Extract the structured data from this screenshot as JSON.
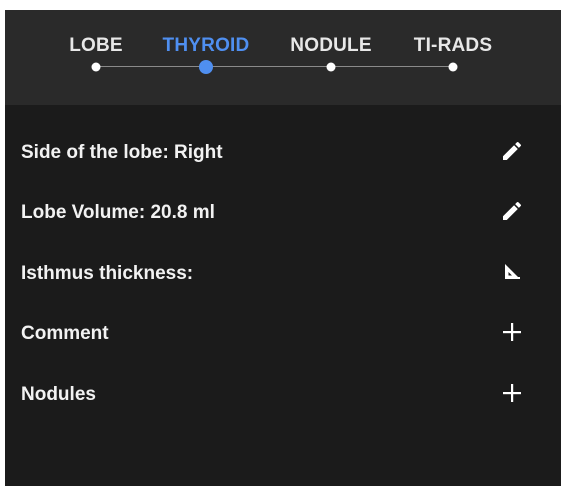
{
  "stepper": {
    "steps": [
      {
        "label": "LOBE",
        "active": false
      },
      {
        "label": "THYROID",
        "active": true
      },
      {
        "label": "NODULE",
        "active": false
      },
      {
        "label": "TI-RADS",
        "active": false
      }
    ],
    "active_color": "#4f8ff0"
  },
  "rows": [
    {
      "label": "Side of the lobe: Right",
      "icon": "pencil-icon"
    },
    {
      "label": "Lobe Volume: 20.8 ml",
      "icon": "pencil-icon"
    },
    {
      "label": "Isthmus thickness:",
      "icon": "ruler-triangle-icon"
    },
    {
      "label": "Comment",
      "icon": "plus-icon"
    },
    {
      "label": "Nodules",
      "icon": "plus-icon"
    }
  ]
}
